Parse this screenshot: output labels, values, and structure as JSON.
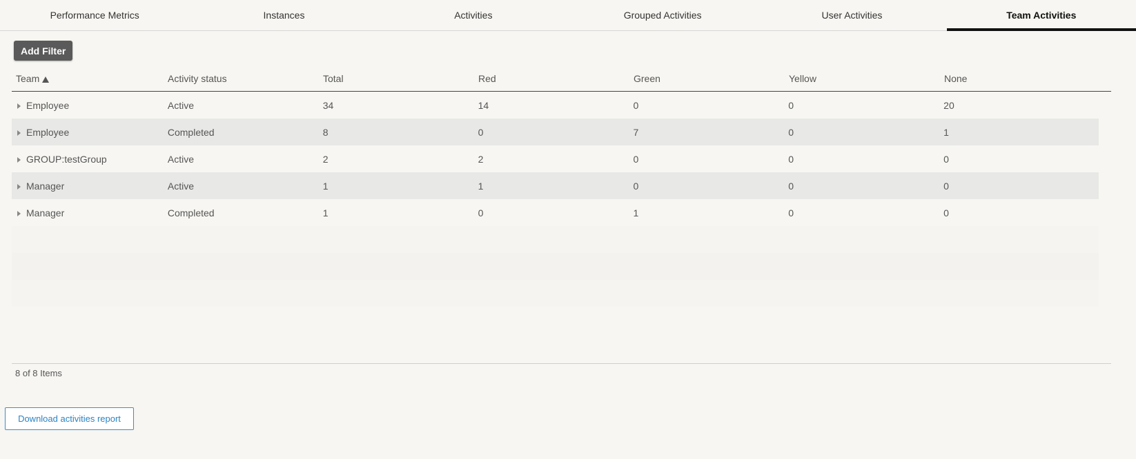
{
  "tabs": [
    {
      "label": "Performance Metrics"
    },
    {
      "label": "Instances"
    },
    {
      "label": "Activities"
    },
    {
      "label": "Grouped Activities"
    },
    {
      "label": "User Activities"
    },
    {
      "label": "Team Activities"
    }
  ],
  "toolbar": {
    "add_filter_label": "Add Filter"
  },
  "table": {
    "columns": [
      "Team",
      "Activity status",
      "Total",
      "Red",
      "Green",
      "Yellow",
      "None"
    ],
    "sort_column": "Team",
    "rows": [
      [
        "Employee",
        "Active",
        "34",
        "14",
        "0",
        "0",
        "20"
      ],
      [
        "Employee",
        "Completed",
        "8",
        "0",
        "7",
        "0",
        "1"
      ],
      [
        "GROUP:testGroup",
        "Active",
        "2",
        "2",
        "0",
        "0",
        "0"
      ],
      [
        "Manager",
        "Active",
        "1",
        "1",
        "0",
        "0",
        "0"
      ],
      [
        "Manager",
        "Completed",
        "1",
        "0",
        "1",
        "0",
        "0"
      ]
    ]
  },
  "footer": {
    "count": "8 of 8 Items"
  },
  "download": {
    "label": "Download activities report"
  }
}
